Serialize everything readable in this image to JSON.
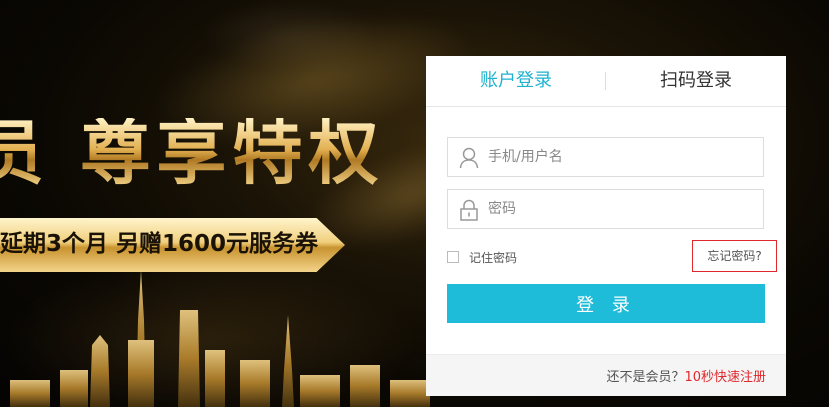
{
  "promo": {
    "headline": "员 尊享特权",
    "banner": "延期3个月  另赠1600元服务券"
  },
  "login": {
    "tabs": [
      {
        "label": "账户登录",
        "active": true
      },
      {
        "label": "扫码登录",
        "active": false
      }
    ],
    "username_placeholder": "手机/用户名",
    "password_placeholder": "密码",
    "remember_label": "记住密码",
    "forgot_label": "忘记密码?",
    "submit_label": "登 录",
    "footer": {
      "not_member": "还不是会员？",
      "register_link": "10秒快速注册"
    }
  },
  "colors": {
    "accent": "#1fbcd9",
    "tab_active": "#1fb2cf",
    "link_red": "#e0282d",
    "gold": "#e2b050"
  },
  "icons": {
    "username": "user-icon",
    "password": "lock-icon"
  }
}
